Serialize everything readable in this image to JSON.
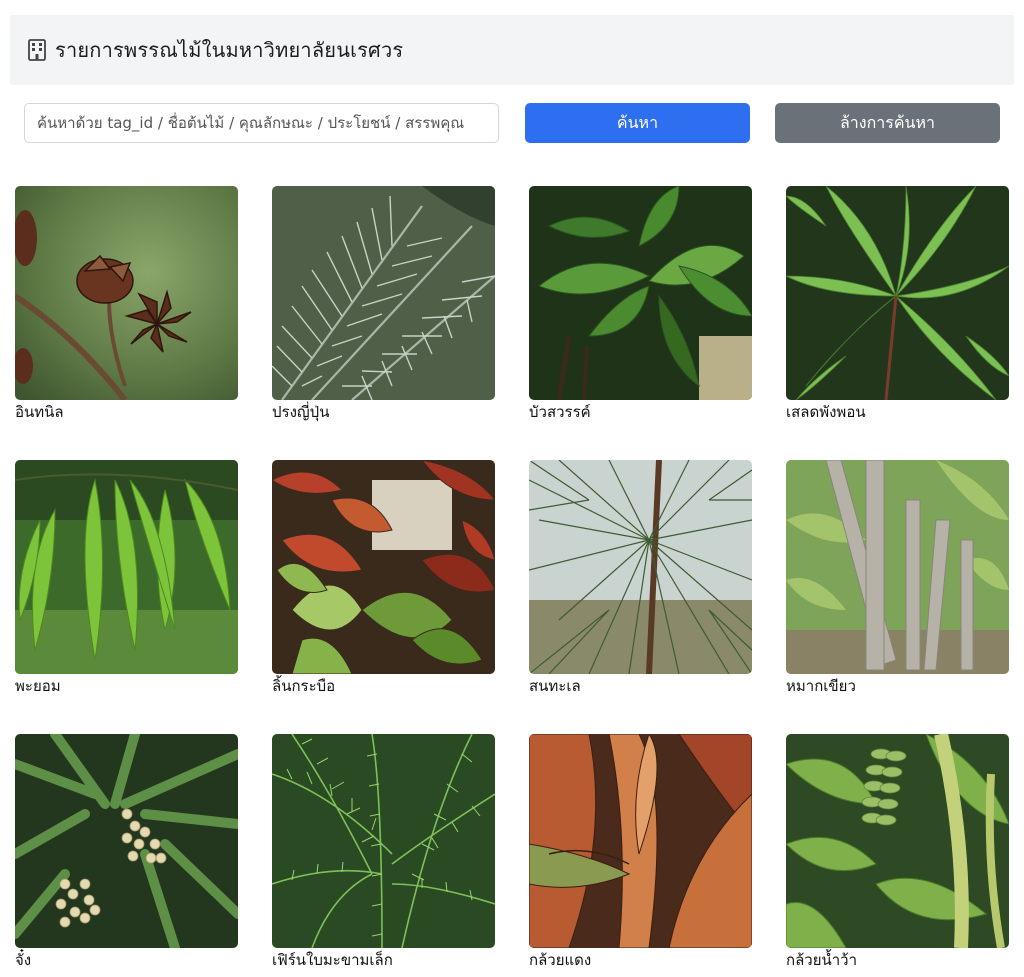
{
  "header": {
    "icon": "building-icon",
    "title": "รายการพรรณไม้ในมหาวิทยาลัยนเรศวร"
  },
  "search": {
    "placeholder": "ค้นหาด้วย tag_id / ชื่อต้นไม้ / คุณลักษณะ / ประโยชน์ / สรรพคุณ",
    "value": "",
    "search_button": "ค้นหา",
    "clear_button": "ล้างการค้นหา"
  },
  "colors": {
    "primary": "#2d6ff0",
    "secondary": "#6b7178",
    "header_bg": "#f3f4f5"
  },
  "plants": [
    {
      "name": "อินทนิล",
      "image": "plant-photo-seed-pods"
    },
    {
      "name": "ปรงญี่ปุ่น",
      "image": "plant-photo-cycad-fronds"
    },
    {
      "name": "บัวสวรรค์",
      "image": "plant-photo-broad-leaves"
    },
    {
      "name": "เสลดพังพอน",
      "image": "plant-photo-narrow-leaves"
    },
    {
      "name": "พะยอม",
      "image": "plant-photo-drooping-leaves"
    },
    {
      "name": "ลิ้นกระบือ",
      "image": "plant-photo-red-green-shrub"
    },
    {
      "name": "สนทะเล",
      "image": "plant-photo-pine-needles"
    },
    {
      "name": "หมากเขียว",
      "image": "plant-photo-palm-trunks"
    },
    {
      "name": "จั๋ง",
      "image": "plant-photo-palm-fruit"
    },
    {
      "name": "เฟิร์นใบมะขามเล็ก",
      "image": "plant-photo-fern"
    },
    {
      "name": "กล้วยแดง",
      "image": "plant-photo-red-banana"
    },
    {
      "name": "กล้วยน้ำว้า",
      "image": "plant-photo-banana-bunch"
    }
  ]
}
